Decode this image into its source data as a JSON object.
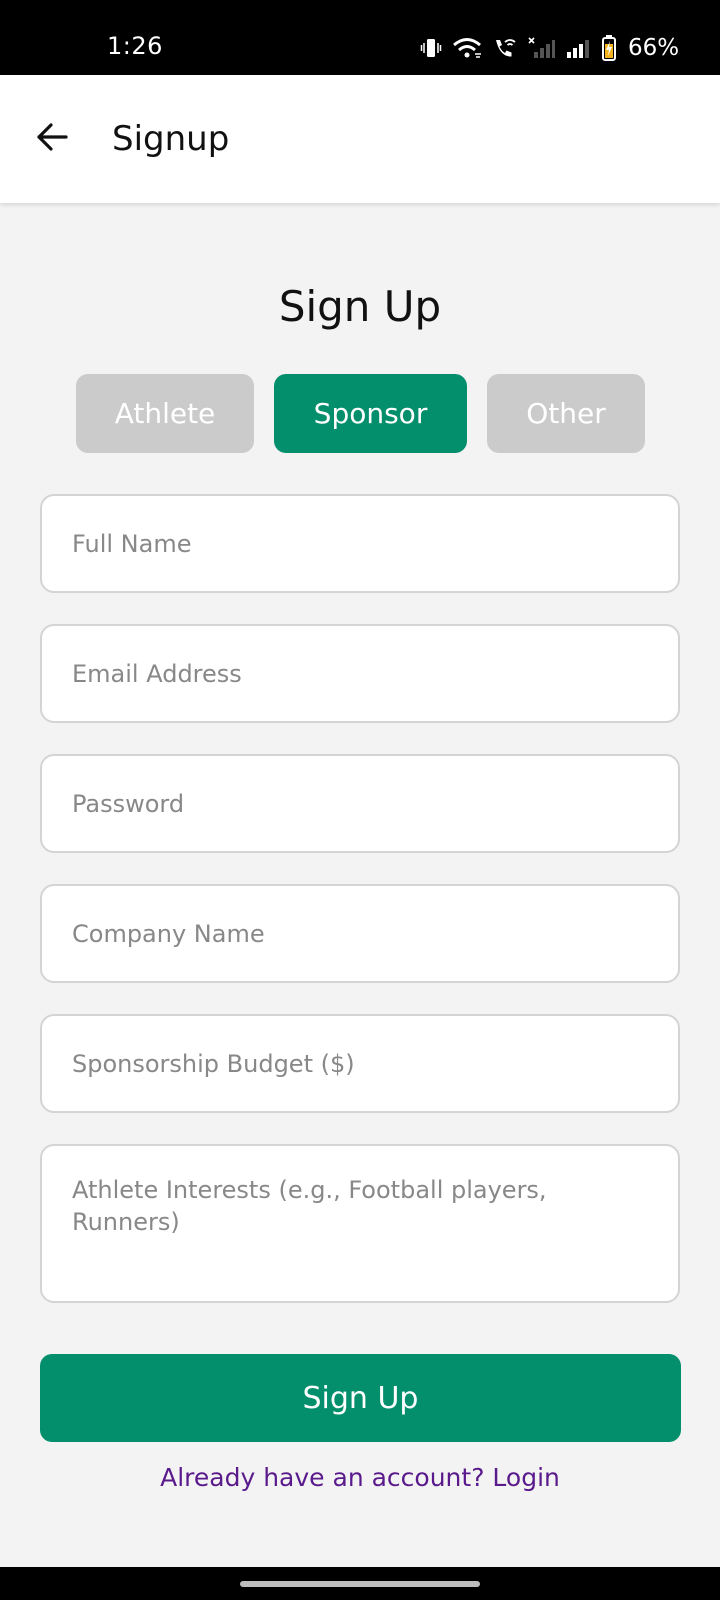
{
  "status_bar": {
    "time": "1:26",
    "battery_percent": "66%",
    "icons": [
      "vibrate-icon",
      "wifi-icon",
      "wifi-calling-icon",
      "signal-no-service-icon",
      "signal-icon",
      "battery-charging-icon"
    ]
  },
  "app_bar": {
    "title": "Signup",
    "back_icon": "arrow-left-icon"
  },
  "main": {
    "heading": "Sign Up",
    "role_tabs": [
      {
        "label": "Athlete",
        "selected": false
      },
      {
        "label": "Sponsor",
        "selected": true
      },
      {
        "label": "Other",
        "selected": false
      }
    ],
    "fields": {
      "full_name": {
        "placeholder": "Full Name",
        "value": ""
      },
      "email": {
        "placeholder": "Email Address",
        "value": ""
      },
      "password": {
        "placeholder": "Password",
        "value": ""
      },
      "company_name": {
        "placeholder": "Company Name",
        "value": ""
      },
      "budget": {
        "placeholder": "Sponsorship Budget ($)",
        "value": ""
      },
      "athlete_interests": {
        "placeholder": "Athlete Interests (e.g., Football players, Runners)",
        "value": ""
      }
    },
    "submit_label": "Sign Up",
    "login_link": "Already have an account? Login"
  },
  "colors": {
    "accent": "#038f6c",
    "inactive_tab": "#cbcbcb",
    "link": "#5a1a8c",
    "background": "#f3f3f3"
  }
}
